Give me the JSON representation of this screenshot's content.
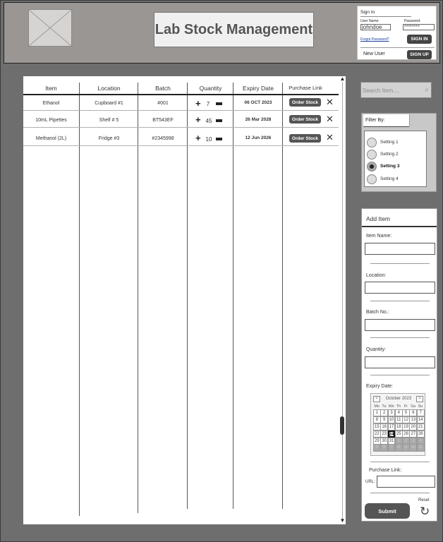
{
  "header": {
    "app_title": "Lab Stock Management",
    "logo_icon": "image-placeholder-icon"
  },
  "signin": {
    "title": "Sign In",
    "username_label": "User Name:",
    "username_value": "johndoe",
    "password_label": "Password:",
    "password_value": "********",
    "forgot_link": "Forgot Password?",
    "signin_button": "SIGN IN",
    "new_user_label": "New User",
    "signup_button": "SIGN UP"
  },
  "table": {
    "columns": [
      "Item",
      "Location",
      "Batch",
      "Quantity",
      "Expiry Date",
      "Purchase Link"
    ],
    "rows": [
      {
        "item": "Ethanol",
        "location": "Cupboard #1",
        "batch": "#001",
        "quantity": "7",
        "expiry": "06 OCT 2023",
        "action": "Order Stock"
      },
      {
        "item": "10mL Pipettes",
        "location": "Shelf # 5",
        "batch": "BT543EF",
        "quantity": "45",
        "expiry": "26 Mar 2028",
        "action": "Order Stock"
      },
      {
        "item": "Methanol (2L)",
        "location": "Fridge #3",
        "batch": "#2345998",
        "quantity": "10",
        "expiry": "12 Jun 2026",
        "action": "Order Stock"
      }
    ],
    "plus_glyph": "+",
    "delete_glyph": "✕",
    "scroll_up_glyph": "▲",
    "scroll_down_glyph": "▼"
  },
  "search": {
    "placeholder": "Search Item....",
    "icon_glyph": "⌕"
  },
  "filter": {
    "title": "Filter By:",
    "options": [
      {
        "label": "Setting 1",
        "selected": false
      },
      {
        "label": "Setting 2",
        "selected": false
      },
      {
        "label": "Setting 3",
        "selected": true
      },
      {
        "label": "Setting 4",
        "selected": false
      }
    ]
  },
  "add_item": {
    "title": "Add Item",
    "item_name_label": "Item Name:",
    "location_label": "Location:",
    "batch_label": "Batch No.:",
    "quantity_label": "Quantity:",
    "expiry_label": "Expiry Date:",
    "purchase_label": "Purchase Link:",
    "url_label": "URL:",
    "submit_button": "Submit",
    "reset_label": "Reset",
    "reset_glyph": "↻"
  },
  "calendar": {
    "month_label": "October 2023",
    "prev": "<",
    "next": ">",
    "dow": [
      "Mo",
      "Tu",
      "We",
      "Th",
      "Fr",
      "Sa",
      "Su"
    ],
    "days": [
      {
        "d": "1",
        "o": false
      },
      {
        "d": "2",
        "o": false
      },
      {
        "d": "3",
        "o": false
      },
      {
        "d": "4",
        "o": false
      },
      {
        "d": "5",
        "o": false
      },
      {
        "d": "6",
        "o": false
      },
      {
        "d": "7",
        "o": false
      },
      {
        "d": "8",
        "o": false
      },
      {
        "d": "9",
        "o": false
      },
      {
        "d": "10",
        "o": false
      },
      {
        "d": "11",
        "o": false
      },
      {
        "d": "12",
        "o": false
      },
      {
        "d": "13",
        "o": false
      },
      {
        "d": "14",
        "o": false
      },
      {
        "d": "15",
        "o": false
      },
      {
        "d": "16",
        "o": false
      },
      {
        "d": "17",
        "o": false
      },
      {
        "d": "18",
        "o": false
      },
      {
        "d": "19",
        "o": false
      },
      {
        "d": "20",
        "o": false
      },
      {
        "d": "21",
        "o": false
      },
      {
        "d": "22",
        "o": false
      },
      {
        "d": "23",
        "o": false
      },
      {
        "d": "24",
        "o": false,
        "sel": true
      },
      {
        "d": "25",
        "o": false
      },
      {
        "d": "26",
        "o": false
      },
      {
        "d": "27",
        "o": false
      },
      {
        "d": "28",
        "o": false
      },
      {
        "d": "29",
        "o": false
      },
      {
        "d": "30",
        "o": false
      },
      {
        "d": "31",
        "o": false
      },
      {
        "d": "1",
        "o": true
      },
      {
        "d": "2",
        "o": true
      },
      {
        "d": "3",
        "o": true
      },
      {
        "d": "4",
        "o": true
      },
      {
        "d": "5",
        "o": true
      },
      {
        "d": "6",
        "o": true
      },
      {
        "d": "7",
        "o": true
      },
      {
        "d": "8",
        "o": true
      },
      {
        "d": "9",
        "o": true
      },
      {
        "d": "10",
        "o": true
      },
      {
        "d": "11",
        "o": true
      }
    ]
  }
}
